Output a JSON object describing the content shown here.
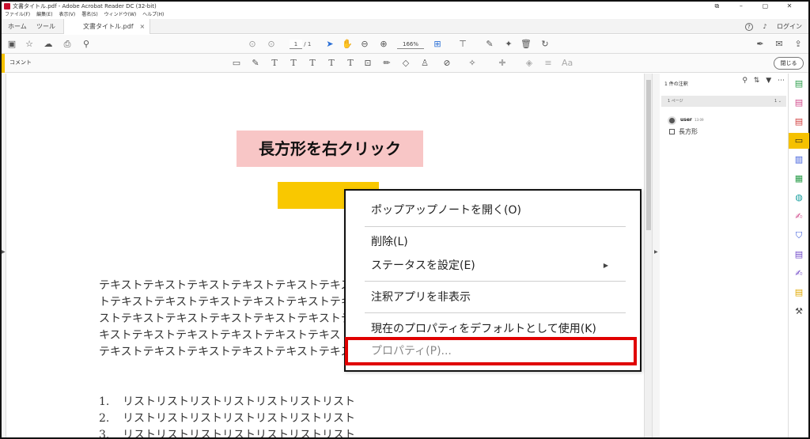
{
  "window": {
    "title": "文書タイトル.pdf - Adobe Acrobat Reader DC (32-bit)",
    "controls": [
      "⧉",
      "–",
      "▢",
      "✕"
    ]
  },
  "menu": [
    "ファイル(F)",
    "編集(E)",
    "表示(V)",
    "署名(S)",
    "ウィンドウ(W)",
    "ヘルプ(H)"
  ],
  "tabs": {
    "home": "ホーム",
    "tools": "ツール",
    "document": "文書タイトル.pdf",
    "close_glyph": "×",
    "login": "ログイン"
  },
  "toolbar": {
    "page_current": "1",
    "page_total": "/ 1",
    "zoom": "166%"
  },
  "comment_bar": {
    "label": "コメント",
    "close_label": "閉じる"
  },
  "document": {
    "heading": "長方形を右クリック",
    "paragraph_lines": [
      "テキストテキストテキストテキストテキストテキスト",
      "トテキストテキストテキストテキストテキストテキス",
      "ストテキストテキストテキストテキストテキストテキ",
      "キストテキストテキストテキストテキストテキストテ",
      "テキストテキストテキストテキストテキストテキスト"
    ],
    "list": [
      {
        "num": "1.",
        "text": "リストリストリストリストリストリストリスト"
      },
      {
        "num": "2.",
        "text": "リストリストリストリストリストリストリスト"
      },
      {
        "num": "3.",
        "text": "リストリストリストリストリストリストリスト"
      }
    ]
  },
  "context_menu": {
    "open_popup": "ポップアップノートを開く(O)",
    "delete": "削除(L)",
    "set_status": "ステータスを設定(E)",
    "hide_app": "注釈アプリを非表示",
    "use_default": "現在のプロパティをデフォルトとして使用(K)",
    "properties": "プロパティ(P)...",
    "submenu_arrow": "▶"
  },
  "comments_pane": {
    "header": "1 件の注釈",
    "page_label": "1 ページ",
    "page_count": "1",
    "user": "user",
    "time": "13:09",
    "annotation_type": "長方形"
  },
  "colors": {
    "accent": "#f5c100",
    "highlight_box": "#e00000",
    "heading_bg": "#f8c6c6",
    "rectangle": "#f9c800"
  }
}
